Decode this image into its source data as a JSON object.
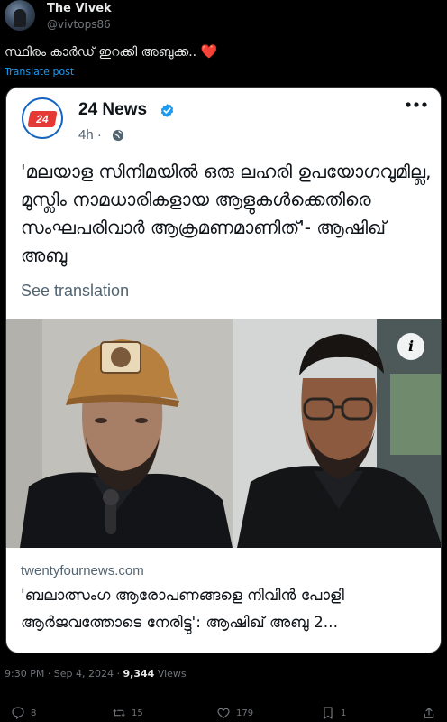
{
  "author": {
    "display_name": "The Vivek",
    "handle": "@vivtops86"
  },
  "tweet": {
    "text": "സ്ഥിരം കാർഡ് ഇറക്കി അബുക്ക.. ",
    "heart": "❤️",
    "translate_label": "Translate post"
  },
  "quoted": {
    "logo_text": "24",
    "name": "24 News",
    "time": "4h",
    "separator": "·",
    "text": "'മലയാള സിനിമയിൽ ഒരു ലഹരി ഉപയോഗവുമില്ല, മുസ്ലിം നാമധാരികളായ ആളുകൾക്കെതിരെ സംഘപരിവാർ ആക്രമണമാണിത്'- ആഷിഖ് അബു",
    "see_translation": "See translation",
    "link_domain": "twentyfournews.com",
    "link_title": "'ബലാത്സംഗ ആരോപണങ്ങളെ നിവിൻ പോളി ആർജവത്തോടെ നേരിട്ടു': ആഷിഖ് അബു 2..."
  },
  "meta": {
    "time_date": "9:30 PM · Sep 4, 2024 · ",
    "views_count": "9,344",
    "views_label": " Views"
  },
  "actions": {
    "replies": "8",
    "reposts": "15",
    "likes": "179",
    "bookmarks": "1"
  },
  "colors": {
    "accent": "#1d9bf0",
    "heart": "#f91880",
    "verified": "#1d9bf0"
  }
}
